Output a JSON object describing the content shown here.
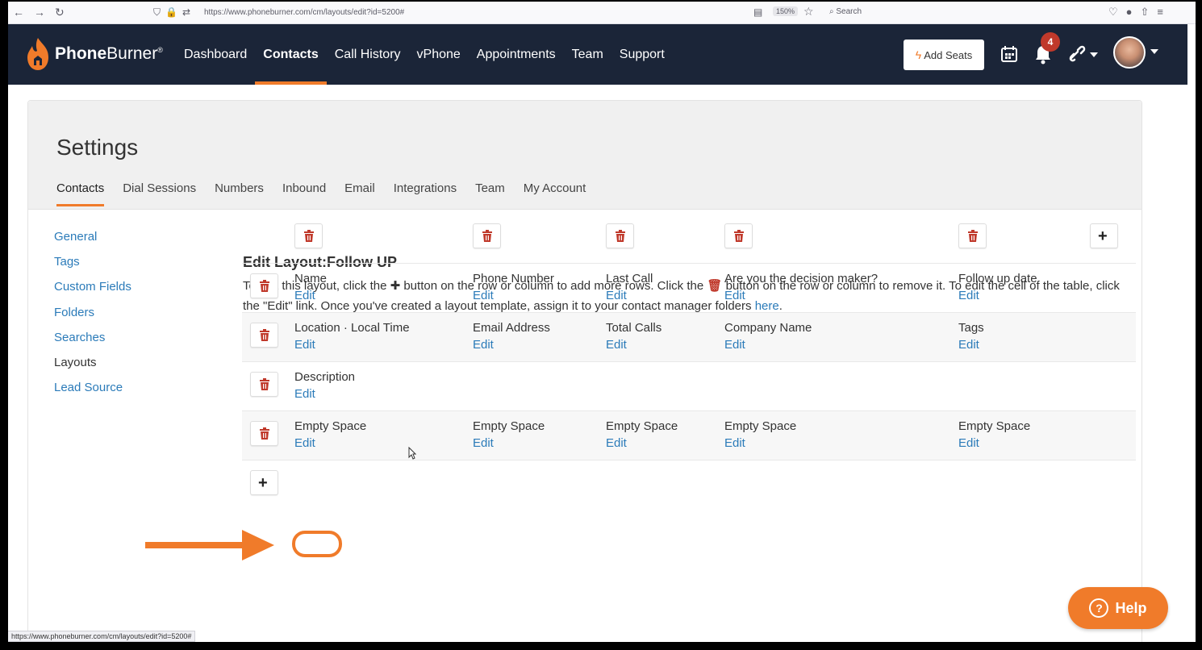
{
  "browser": {
    "url": "https://www.phoneburner.com/cm/layouts/edit?id=5200#",
    "zoom": "150%",
    "search_placeholder": "Search",
    "status_url": "https://www.phoneburner.com/cm/layouts/edit?id=5200#"
  },
  "app": {
    "brand_bold": "Phone",
    "brand_light": "Burner",
    "brand_mark": "®",
    "nav": [
      {
        "label": "Dashboard",
        "active": false
      },
      {
        "label": "Contacts",
        "active": true
      },
      {
        "label": "Call History",
        "active": false
      },
      {
        "label": "vPhone",
        "active": false
      },
      {
        "label": "Appointments",
        "active": false
      },
      {
        "label": "Team",
        "active": false
      },
      {
        "label": "Support",
        "active": false
      }
    ],
    "add_seats": "Add Seats",
    "notification_count": "4",
    "accent": "#f07b2a",
    "header_bg": "#1b2538"
  },
  "settings": {
    "title": "Settings",
    "tabs": [
      "Contacts",
      "Dial Sessions",
      "Numbers",
      "Inbound",
      "Email",
      "Integrations",
      "Team",
      "My Account"
    ],
    "active_tab": "Contacts",
    "sidenav": [
      "General",
      "Tags",
      "Custom Fields",
      "Folders",
      "Searches",
      "Layouts",
      "Lead Source"
    ],
    "active_sidenav": "Layouts"
  },
  "editor": {
    "title": "Edit Layout:Follow UP",
    "desc_1": "To edit this layout, click the ",
    "desc_2": " button on the row or column to add more rows. Click the ",
    "desc_3": " button on the row or column to remove it. To edit the cell of the table, click the \"Edit\" link. Once you've created a layout template, assign it to your contact manager folders ",
    "desc_link": "here",
    "desc_end": ".",
    "edit_label": "Edit",
    "rows": [
      [
        "Name",
        "Phone Number",
        "Last Call",
        "Are you the decision maker?",
        "Follow up date"
      ],
      [
        "Location · Local Time",
        "Email Address",
        "Total Calls",
        "Company Name",
        "Tags"
      ],
      [
        "Description",
        "",
        "",
        "",
        ""
      ],
      [
        "Empty Space",
        "Empty Space",
        "Empty Space",
        "Empty Space",
        "Empty Space"
      ]
    ]
  },
  "help": {
    "label": "Help"
  }
}
